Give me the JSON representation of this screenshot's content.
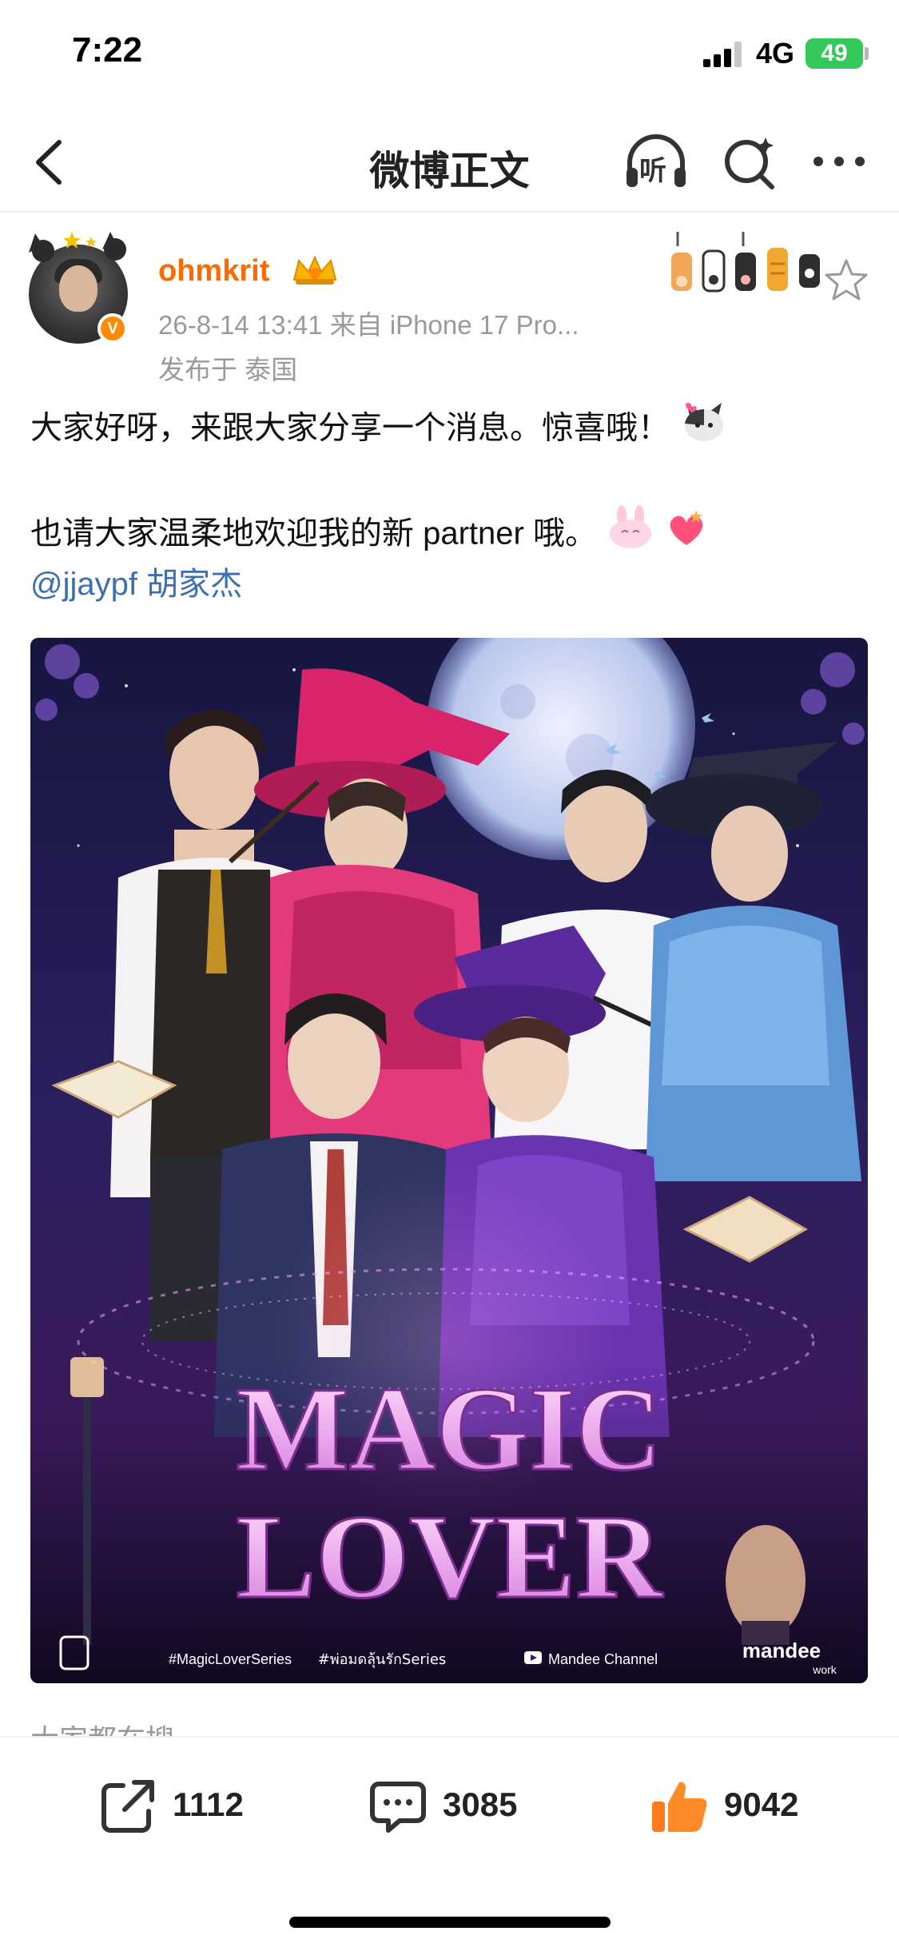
{
  "status_bar": {
    "time": "7:22",
    "network": "4G",
    "battery": "49"
  },
  "nav": {
    "title": "微博正文",
    "listen_label": "听",
    "icons": [
      "back-chevron-icon",
      "headphones-icon",
      "search-icon",
      "more-icon"
    ]
  },
  "post": {
    "author": "ohmkrit",
    "meta": "26-8-14 13:41  来自 iPhone 17 Pro...",
    "location": "发布于 泰国",
    "verified_badge": "V",
    "text_line1": "大家好呀，来跟大家分享一个消息。惊喜哦！",
    "text_line2": "也请大家温柔地欢迎我的新 partner 哦。",
    "mention": "@jjaypf 胡家杰",
    "image": {
      "title_line1": "MAGIC",
      "title_line2": "LOVER",
      "hashtag1": "#MagicLoverSeries",
      "hashtag2": "#พ่อมดลุ้นรักSeries",
      "channel": "Mandee Channel",
      "brand": "mandee",
      "brand_sub": "work"
    }
  },
  "hot_search_label": "大家都在搜",
  "actions": {
    "repost_count": "1112",
    "comment_count": "3085",
    "like_count": "9042"
  },
  "colors": {
    "username": "#ff6a00",
    "mention": "#3c6faf",
    "meta": "#9a9a9a",
    "battery": "#34c759",
    "like": "#ff7a1a"
  }
}
